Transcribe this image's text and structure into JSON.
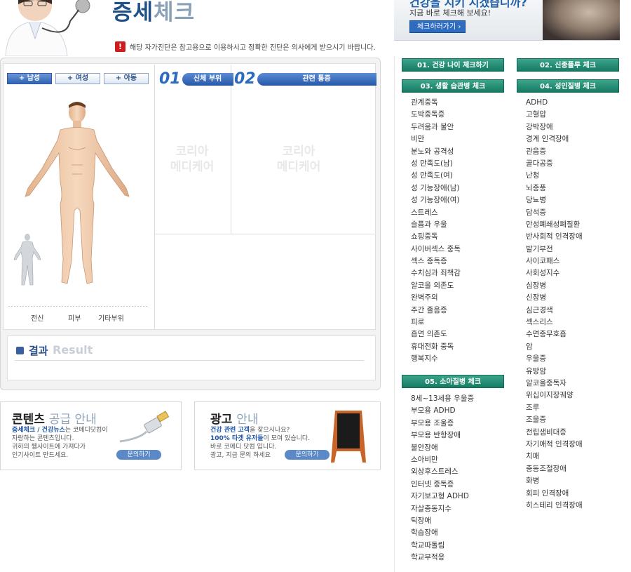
{
  "header": {
    "brand_main": "증세",
    "brand_sub": "체크",
    "notice_icon": "!",
    "notice_text": "해당 자가진단은 참고용으로 이용하시고 정확한 진단은 의사에게 받으시기 바랍니다."
  },
  "banner": {
    "title": "건강을 지키 시겠습니까?",
    "subtitle": "지금 바로 체크해 보세요!",
    "button": "체크하러가기 ›"
  },
  "body_check": {
    "gender_buttons": [
      "+ 남성",
      "+ 여성",
      "+ 아동"
    ],
    "col1_num": "01",
    "col1_label": "신체 부위",
    "col2_num": "02",
    "col2_label": "관련 통증",
    "watermark": "코리아\n메디케어",
    "parts": [
      "전신",
      "피부",
      "기타부위"
    ]
  },
  "result": {
    "label": "결과",
    "label_en": "Result"
  },
  "promo_content": {
    "title_main": "콘텐츠",
    "title_sub": "공급 안내",
    "line1_bold": "증세체크 / 건강뉴스",
    "line1_rest": "는 코메디닷컴이",
    "line2": "자랑하는 콘텐츠입니다.",
    "line3": "귀하의 웹사이트에 가져다가",
    "line4": "인기사이트 만드세요.",
    "button": "문의하기"
  },
  "promo_ad": {
    "title_main": "광고",
    "title_sub": "안내",
    "line1_bold": "건강 관련 고객",
    "line1_rest": "을 찾으시나요?",
    "line2_bold": "100% 타겟 유저들",
    "line2_rest": "이 모여 있습니다.",
    "line3": "바로 코메디 닷컴 입니다.",
    "line4": "광고, 지금 문의 하세요",
    "button": "문의하기"
  },
  "categories": {
    "c1": "01. 건강 나이 체크하기",
    "c2": "02. 신종플루 체크",
    "c3": "03. 생활 습관병 체크",
    "c4": "04. 성인질병 체크",
    "c5": "05. 소아질병 체크"
  },
  "lifestyle_items": [
    "관계중독",
    "도박중독증",
    "두려움과 불안",
    "비만",
    "분노와 공격성",
    "성 만족도(남)",
    "성 만족도(여)",
    "성 기능장애(남)",
    "성 기능장애(여)",
    "스트레스",
    "슬픔과 우울",
    "쇼핑중독",
    "사이버섹스 중독",
    "섹스 중독증",
    "수치심과 죄책감",
    "알코올 의존도",
    "완벽주의",
    "주간 졸음증",
    "피로",
    "흡연 의존도",
    "휴대전화 중독",
    "행복지수"
  ],
  "adult_items": [
    "ADHD",
    "고혈압",
    "강박장애",
    "경계 인격장애",
    "관음증",
    "골다공증",
    "난청",
    "뇌중풍",
    "당뇨병",
    "담석증",
    "만성폐쇄성폐질환",
    "반사회적 인격장애",
    "발기부전",
    "사이코패스",
    "사회성지수",
    "심장병",
    "신장병",
    "심근경색",
    "섹스리스",
    "수면중무호흡",
    "암",
    "우울증",
    "유방암",
    "알코올중독자",
    "위십이지장궤양",
    "조루",
    "조울증",
    "전립샘비대증",
    "자기애적 인격장애",
    "치매",
    "충동조절장애",
    "화병",
    "회피 인격장애",
    "히스테리 인격장애"
  ],
  "child_items": [
    "8세~13세용 우울증",
    "부모용 ADHD",
    "부모용 조울증",
    "부모용 반항장애",
    "불안장애",
    "소아비만",
    "외상후스트레스",
    "인터넷 중독증",
    "자기보고형 ADHD",
    "자살충동지수",
    "틱장애",
    "학습장애",
    "학교따돌림",
    "학교부적응"
  ]
}
